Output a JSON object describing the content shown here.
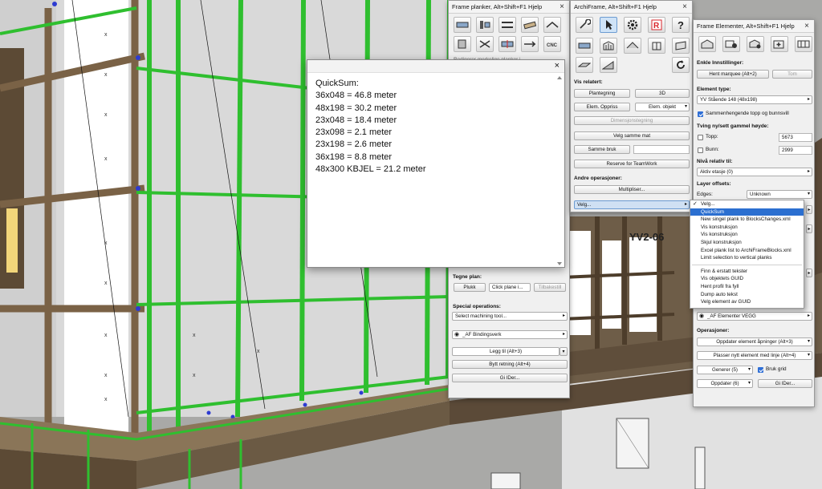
{
  "frame_planker": {
    "title": "Frame planker, Alt+Shift+F1 Hjelp",
    "hidden_line": "Redigerer merkelige planker i ...",
    "section_tegne_plan": "Tegne plan:",
    "btn_plukk": "Plukk",
    "dd_click_plane": "Click plane i...",
    "btn_tilbakestill": "Tilbakestill",
    "section_special": "Special operations:",
    "dd_machining": "Select machining tool...",
    "dd_bindingsverk": "_AF Bindingsverk",
    "btn_legg_til": "Legg til (Alt+3)",
    "btn_bytt_retning": "Bytt retning (Alt+4)",
    "btn_gi_ider": "Gi IDer..."
  },
  "archiframe": {
    "title": "ArchiFrame, Alt+Shift+F1 Hjelp",
    "section_vis_relatert": "Vis relatert:",
    "btn_plantegning": "Plantegning",
    "btn_3d": "3D",
    "btn_elem_oppriss": "Elem. Oppriss",
    "btn_elem_objekt": "Elem. objekt",
    "btn_dimensjon": "Dimensjonstegning",
    "btn_velg_samme_mat": "Velg samme mat",
    "btn_samme_bruk": "Samme bruk",
    "btn_reserve": "Reserve for TeamWork",
    "section_andre": "Andre operasjoner:",
    "btn_multipliser": "Multipliser...",
    "dd_velg": "Velg..."
  },
  "quicksum": {
    "title_line": "QuickSum:",
    "lines": [
      "36x048 = 46.8 meter",
      "48x198 = 30.2 meter",
      "23x048 = 18.4 meter",
      "23x098 = 2.1 meter",
      "23x198 = 2.6 meter",
      "36x198 = 8.8 meter",
      "48x300 KBJEL = 21.2 meter"
    ]
  },
  "frame_elementer": {
    "title": "Frame Elementer, Alt+Shift+F1 Hjelp",
    "section_enkle": "Enkle Innstillinger:",
    "btn_hent_marquee": "Hent marquee (Alt+2)",
    "btn_tom": "Tom",
    "section_element_type": "Element type:",
    "dd_element_type": "YV Stående 148 (48x198)",
    "chk_sammenhengende": "Sammenhengende topp og bunnsvill",
    "section_tving": "Tving ny/sett gammel høyde:",
    "chk_topp": "Topp:",
    "val_topp": "5673",
    "chk_bunn": "Bunn:",
    "val_bunn": "2999",
    "section_niva": "Nivå relativ til:",
    "dd_niva": "Aktiv etasje (0)",
    "section_layer": "Layer offsets:",
    "lbl_edges": "Edges:",
    "dd_edges": "Unknown",
    "dd_elementer_vegg": "_AF Elementer VEGG",
    "section_operasjoner": "Operasjoner:",
    "dd_oppdater_apninger": "Oppdater element åpninger (Alt+3)",
    "dd_plasser": "Plasser nytt element med linje (Alt+4)",
    "dd_generer": "Generer (5)",
    "chk_bruk_grid": "Bruk grid",
    "dd_oppdater": "Oppdater (6)",
    "btn_gi_ider": "Gi IDer..."
  },
  "velg_menu": {
    "items": [
      "Velg...",
      "QuickSum",
      "New singel plank to BlocksChanges.xml",
      "Vis konstruksjon",
      "Vis konstruksjon",
      "Skjul konstruksjon",
      "Excel plank list to ArchiFrameBlocks.xml",
      "Limit selection to vertical planks",
      "Finn & erstatt tekster",
      "Vis objektets GUID",
      "Hent profil fra fyll",
      "Dump auto tekst",
      "Velg element av GUID"
    ],
    "checked_index": 0,
    "highlighted_index": 1
  },
  "scene_text": {
    "wall_tag": "YV2-06"
  },
  "colors": {
    "frame_green": "#2fbf2f",
    "timber": "#6b5a44",
    "menu_highlight": "#2b6fd0",
    "revit_red": "#d9262b"
  }
}
